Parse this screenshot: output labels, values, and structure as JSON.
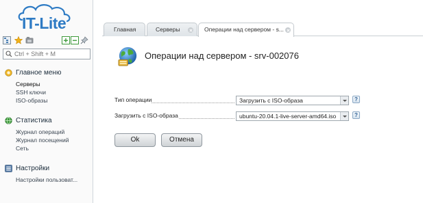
{
  "logo": {
    "text": "IT-Lite"
  },
  "search": {
    "placeholder": "Ctrl + Shift + M"
  },
  "sidebar": {
    "sections": [
      {
        "label": "Главное меню",
        "items": [
          "Серверы",
          "SSH ключи",
          "ISO-образы"
        ]
      },
      {
        "label": "Статистика",
        "items": [
          "Журнал операций",
          "Журнал посещений",
          "Сеть"
        ]
      },
      {
        "label": "Настройки",
        "items": [
          "Настройки пользоват..."
        ]
      }
    ]
  },
  "tabs": [
    {
      "label": "Главная"
    },
    {
      "label": "Серверы"
    },
    {
      "label": "Операции над сервером - s..."
    }
  ],
  "page": {
    "title": "Операции над сервером - srv-002076",
    "fields": [
      {
        "label": "Тип операции",
        "value": "Загрузить с ISO-образа"
      },
      {
        "label": "Загрузить с ISO-образа",
        "value": "ubuntu-20.04.1-live-server-amd64.iso"
      }
    ],
    "help_glyph": "?",
    "ok_label": "Ok",
    "cancel_label": "Отмена"
  },
  "colors": {
    "brand": "#2e7bc4",
    "accent_green": "#3d9a3a"
  }
}
